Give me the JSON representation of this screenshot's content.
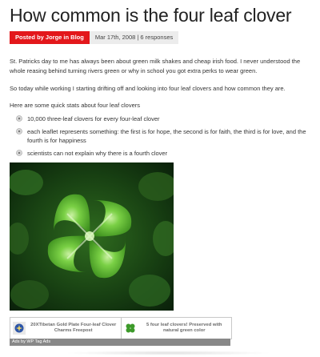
{
  "post": {
    "title": "How common is the four leaf clover",
    "author_badge": "Posted by Jorge in Blog",
    "date_line": "Mar 17th, 2008 | 6 responses",
    "paragraphs": [
      "St. Patricks day to me has always been about green milk shakes and cheap irish food. I never understood the whole reasing behind turning rivers green or why in school you got extra perks to wear green.",
      "So today while working I starting drifting off and looking into four leaf clovers and how common they are.",
      "Here are some quick stats about four leaf clovers"
    ],
    "bullets": [
      "10,000 three-leaf clovers for every four-leaf clover",
      "each leaflet represents something: the first is for hope, the second is for faith, the third is for love, and the fourth is for happiness",
      "scientists can not explain why there is a fourth clover"
    ]
  },
  "ads": {
    "items": [
      {
        "text": "20XTibetan Gold Plate Four-leaf Clover Charms Freepost"
      },
      {
        "text": "5 four leaf clovers! Preserved with natural green color"
      }
    ],
    "footer": "Ads by WP Tag Ads"
  }
}
